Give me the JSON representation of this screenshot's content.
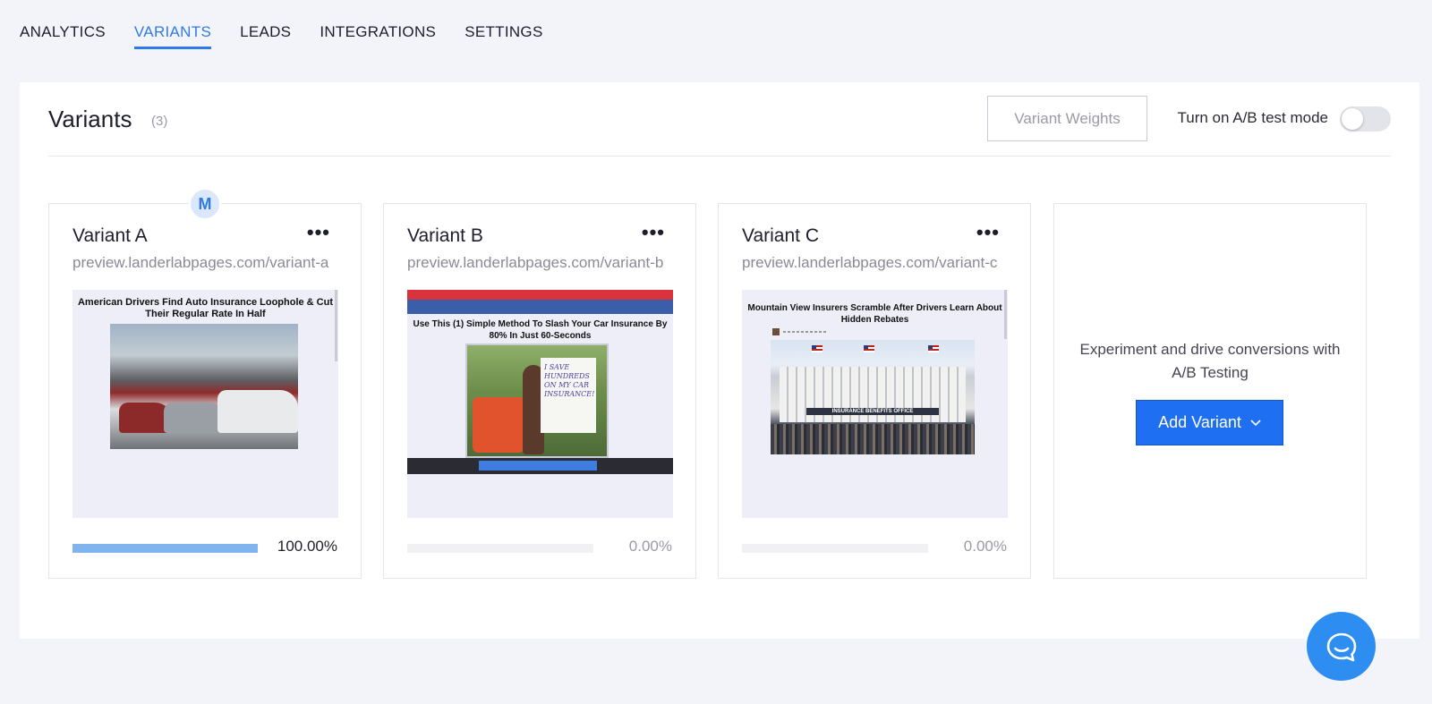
{
  "nav": {
    "tabs": [
      {
        "label": "ANALYTICS",
        "active": false
      },
      {
        "label": "VARIANTS",
        "active": true
      },
      {
        "label": "LEADS",
        "active": false
      },
      {
        "label": "INTEGRATIONS",
        "active": false
      },
      {
        "label": "SETTINGS",
        "active": false
      }
    ]
  },
  "panel": {
    "title": "Variants",
    "count": "(3)",
    "weights_button": "Variant Weights",
    "ab_label": "Turn on A/B test mode",
    "ab_enabled": false
  },
  "variants": [
    {
      "name": "Variant A",
      "url": "preview.landerlabpages.com/variant-a",
      "badge": "M",
      "percent": "100.00%",
      "weight": 1.0,
      "thumb_headline": "American Drivers Find Auto Insurance Loophole & Cut Their Regular Rate In Half"
    },
    {
      "name": "Variant B",
      "url": "preview.landerlabpages.com/variant-b",
      "percent": "0.00%",
      "weight": 0.0,
      "thumb_headline": "Use This (1) Simple Method To Slash Your Car Insurance By 80% In Just 60-Seconds",
      "thumb_sign": "I SAVE HUNDREDS ON MY CAR INSURANCE!"
    },
    {
      "name": "Variant C",
      "url": "preview.landerlabpages.com/variant-c",
      "percent": "0.00%",
      "weight": 0.0,
      "thumb_headline": "Mountain View Insurers Scramble After Drivers Learn About Hidden Rebates",
      "thumb_sign": "INSURANCE BENEFITS OFFICE"
    }
  ],
  "add_card": {
    "text": "Experiment and drive conversions with A/B Testing",
    "button": "Add Variant"
  },
  "colors": {
    "accent": "#2f7be5",
    "primary_button": "#1f6ff2",
    "progress_fill": "#7fb4ee",
    "chat": "#2e8df0"
  },
  "icons": {
    "more": "more-horizontal-icon",
    "chevron": "chevron-down-icon",
    "chat": "chat-bubble-icon"
  }
}
